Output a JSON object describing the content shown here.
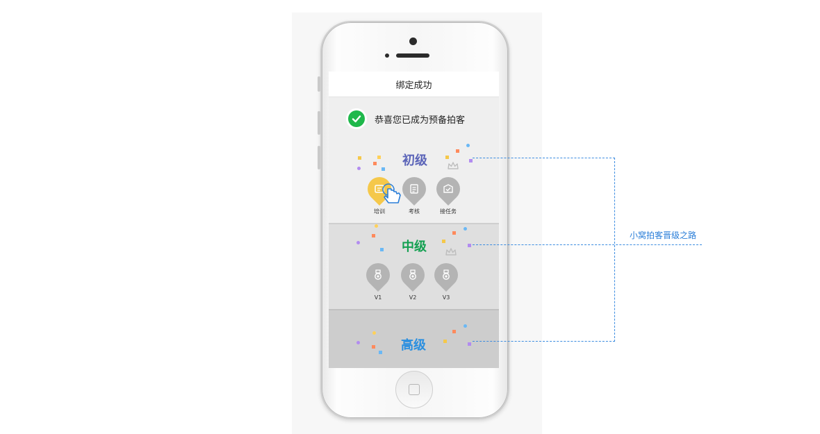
{
  "navbar": {
    "title": "绑定成功"
  },
  "success": {
    "message": "恭喜您已成为预备拍客"
  },
  "levels": {
    "junior": {
      "title": "初级",
      "color": "#5b64b8",
      "items": [
        "培训",
        "考核",
        "接任务"
      ]
    },
    "middle": {
      "title": "中级",
      "color": "#13a051",
      "items": [
        "V1",
        "V2",
        "V3"
      ]
    },
    "senior": {
      "title": "高级",
      "color": "#2a8fe0"
    }
  },
  "annotation": {
    "label": "小窝拍客晋级之路",
    "color": "#3a8be0"
  },
  "colors": {
    "success_green": "#1fb84b",
    "highlight_yellow": "#f5c84a",
    "pin_gray": "#b4b4b4"
  },
  "icons": [
    "check-icon",
    "training-icon",
    "hand-pointer-icon",
    "exam-icon",
    "task-icon",
    "crown-icon",
    "medal-icon"
  ]
}
